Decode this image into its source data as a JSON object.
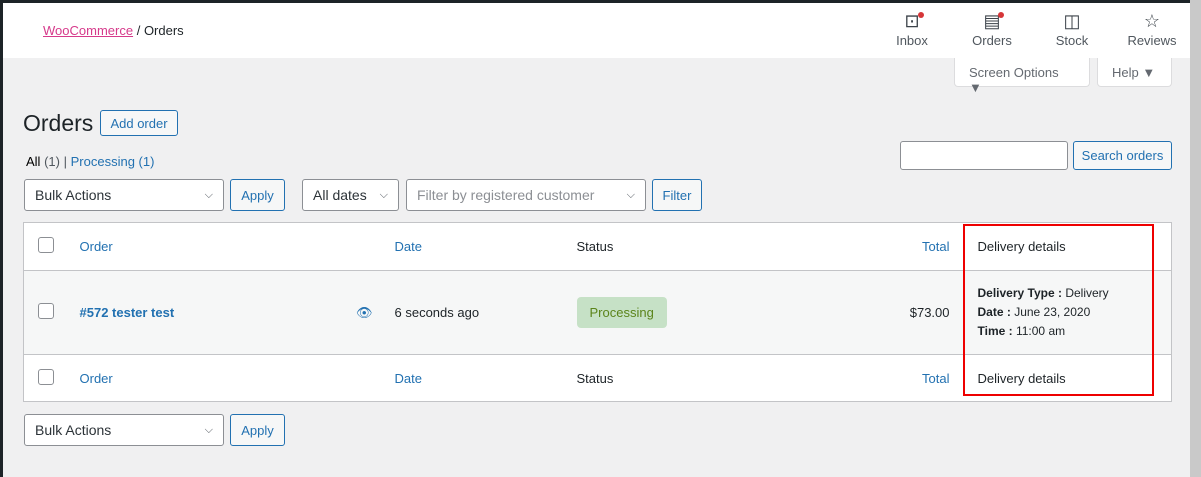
{
  "breadcrumb": {
    "root": "WooCommerce",
    "sep": "/",
    "current": "Orders"
  },
  "header_items": [
    {
      "label": "Inbox",
      "icon": "inbox-icon"
    },
    {
      "label": "Orders",
      "icon": "orders-icon"
    },
    {
      "label": "Stock",
      "icon": "stock-icon"
    },
    {
      "label": "Reviews",
      "icon": "star-icon"
    }
  ],
  "screen_options": "Screen Options ▼",
  "help": "Help ▼",
  "title": "Orders",
  "add_order": "Add order",
  "views": {
    "all": "All",
    "all_count": "(1)",
    "sep": "|",
    "processing": "Processing (1)"
  },
  "search_button": "Search orders",
  "bulk_actions": "Bulk Actions",
  "apply": "Apply",
  "all_dates": "All dates",
  "customer_placeholder": "Filter by registered customer",
  "filter": "Filter",
  "columns": {
    "order": "Order",
    "date": "Date",
    "status": "Status",
    "total": "Total",
    "delivery": "Delivery details"
  },
  "orders": [
    {
      "order": "#572 tester test",
      "date": "6 seconds ago",
      "status": "Processing",
      "total": "$73.00",
      "delivery_type_label": "Delivery Type :",
      "delivery_type": "Delivery",
      "date_label": "Date :",
      "delivery_date": "June 23, 2020",
      "time_label": "Time :",
      "delivery_time": "11:00 am"
    }
  ]
}
